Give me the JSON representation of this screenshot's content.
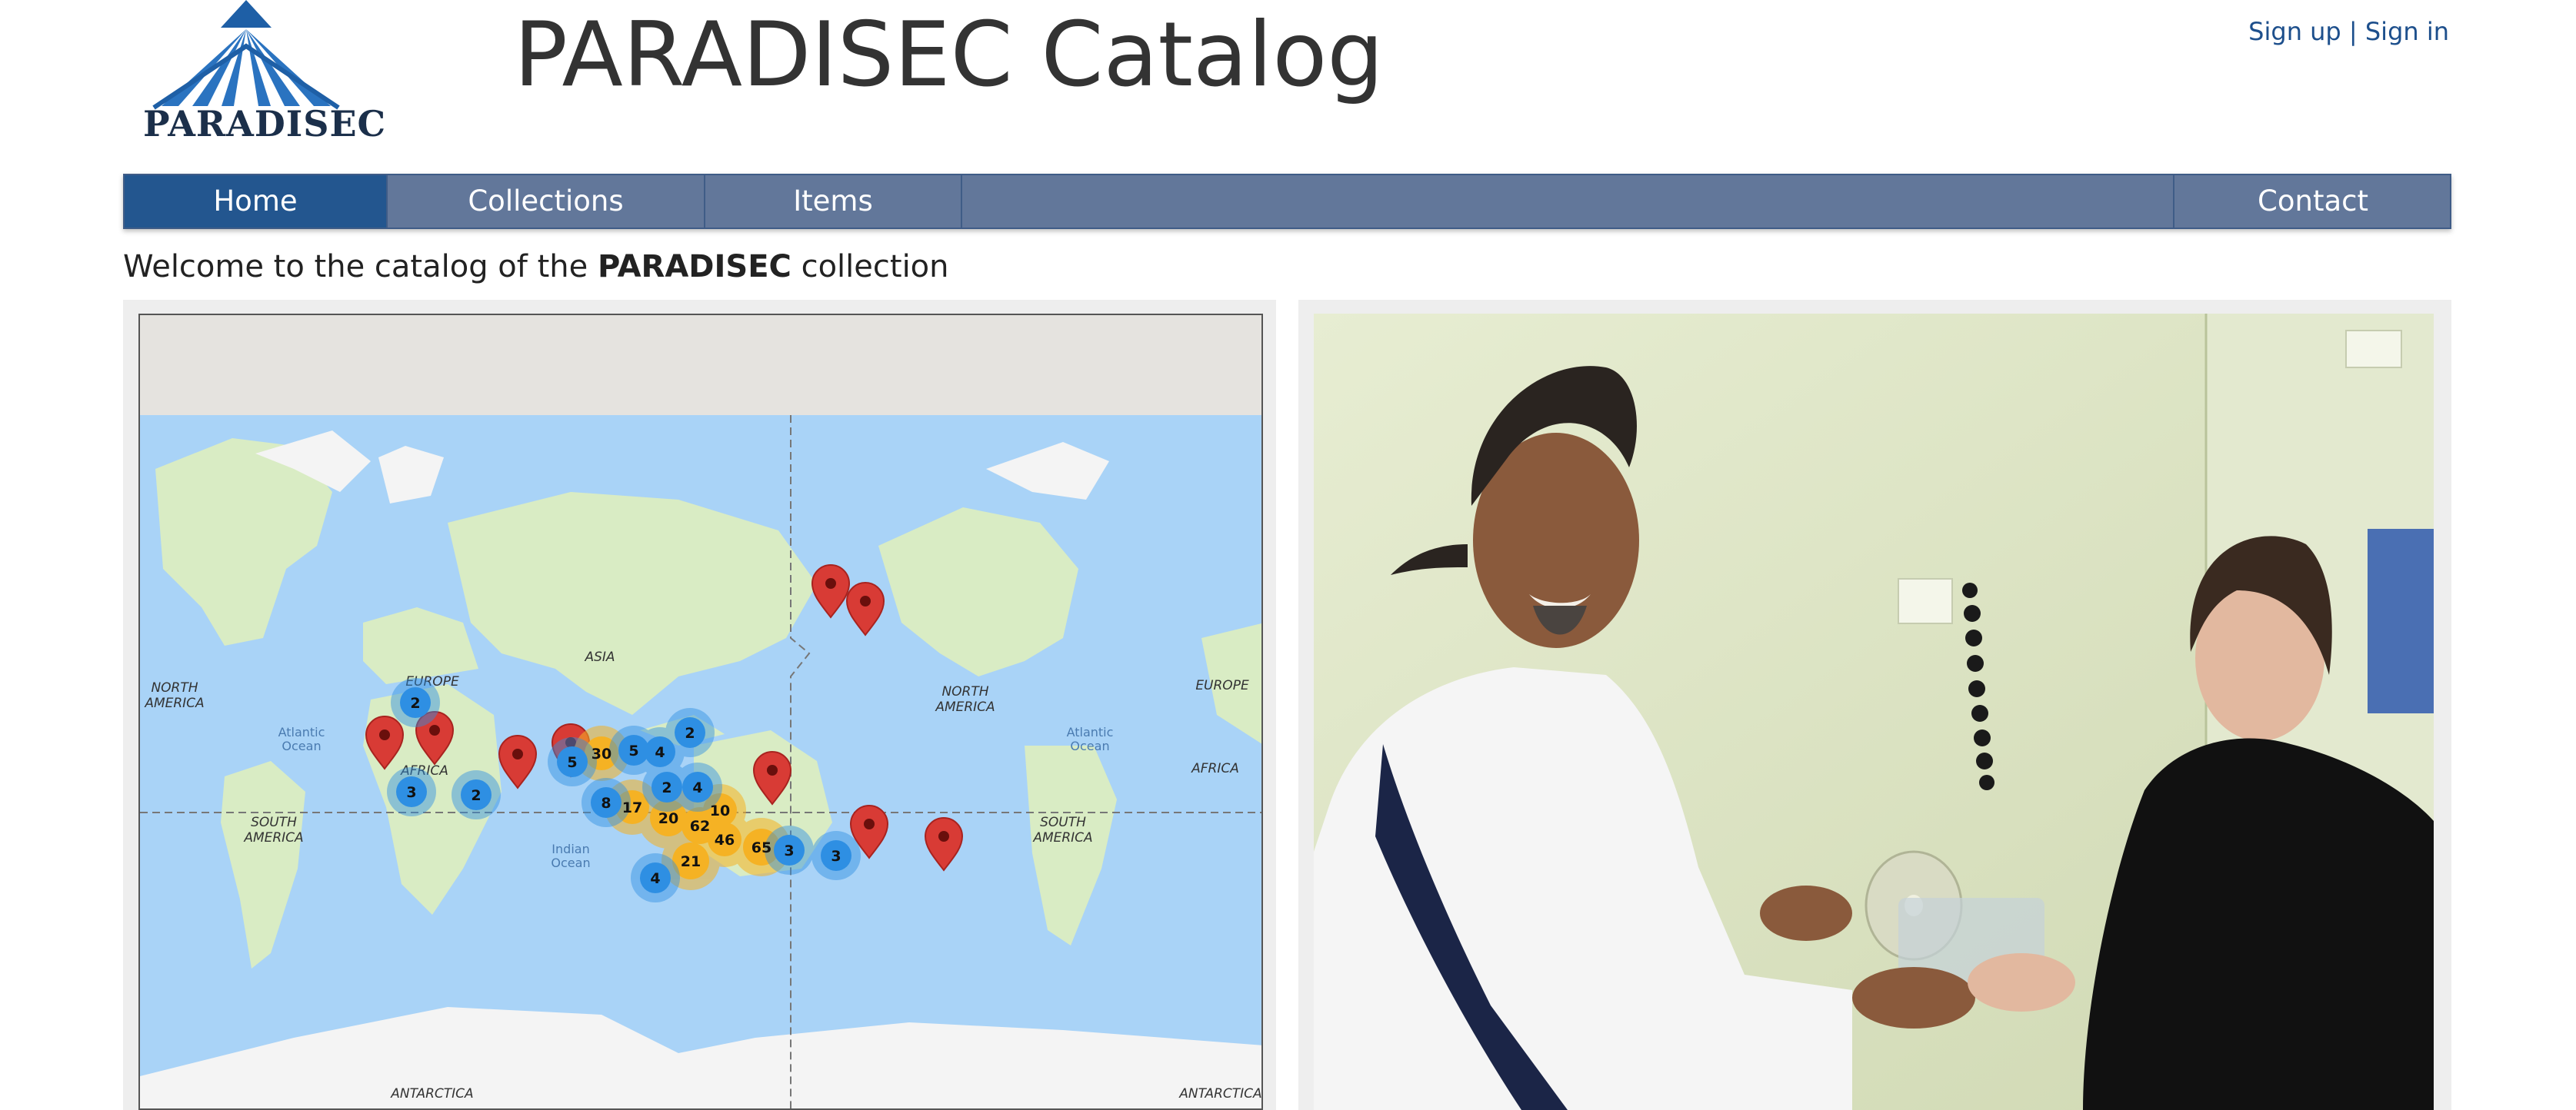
{
  "brand": {
    "name": "PARADISEC",
    "title": "PARADISEC Catalog"
  },
  "auth": {
    "sign_up": "Sign up",
    "separator": "|",
    "sign_in": "Sign in"
  },
  "nav": {
    "items": [
      {
        "label": "Home",
        "active": true
      },
      {
        "label": "Collections",
        "active": false
      },
      {
        "label": "Items",
        "active": false
      },
      {
        "label": "Contact",
        "active": false
      }
    ]
  },
  "welcome": {
    "prefix": "Welcome to the catalog of the",
    "bold": "PARADISEC",
    "suffix": "collection"
  },
  "map": {
    "labels": {
      "europe_left": "EUROPE",
      "europe_right": "EUROPE",
      "asia": "ASIA",
      "africa_left": "AFRICA",
      "africa_right": "AFRICA",
      "na_left_1": "NORTH",
      "na_left_2": "AMERICA",
      "na_right_1": "NORTH",
      "na_right_2": "AMERICA",
      "sa_left_1": "SOUTH",
      "sa_left_2": "AMERICA",
      "sa_right_1": "SOUTH",
      "sa_right_2": "AMERICA",
      "atlantic_left_1": "Atlantic",
      "atlantic_left_2": "Ocean",
      "atlantic_right_1": "Atlantic",
      "atlantic_right_2": "Ocean",
      "indian_1": "Indian",
      "indian_2": "Ocean",
      "antarctica_left": "ANTARCTICA",
      "antarctica_right": "ANTARCTICA"
    },
    "clusters": {
      "c1": "2",
      "c2": "3",
      "c3": "2",
      "c4": "5",
      "c5": "30",
      "c6": "5",
      "c7": "4",
      "c8": "2",
      "c9": "8",
      "c10": "2",
      "c11": "4",
      "c12": "17",
      "c13": "20",
      "c14": "62",
      "c15": "10",
      "c16": "46",
      "c17": "21",
      "c18": "65",
      "c19": "3",
      "c20": "3",
      "c21": "4"
    },
    "colors": {
      "water": "#a9d3f7",
      "land": "#d9ecc4",
      "ice": "#f4f4f4",
      "blue_cluster": "#2e8fe3",
      "orange_cluster": "#f5b224",
      "marker": "#d83b35"
    }
  },
  "colors": {
    "nav_bg": "#62779a",
    "nav_active": "#23568f",
    "link": "#1d4f8c",
    "panel_bg": "#eeeeee"
  }
}
